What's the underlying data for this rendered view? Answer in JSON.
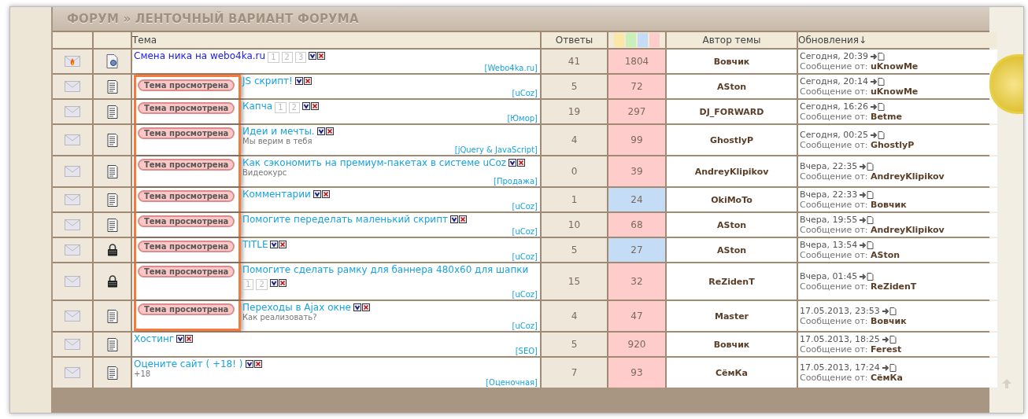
{
  "forum": {
    "title": "ФОРУМ » ЛЕНТОЧНЫЙ ВАРИАНТ ФОРУМА"
  },
  "table": {
    "columns": {
      "topic": "Тема",
      "replies": "Ответы",
      "author": "Автор темы",
      "updates": "Обновления↓"
    },
    "rows": [
      {
        "status_icon": {
          "kind": "hot"
        },
        "type_icon": {
          "kind": "special"
        },
        "viewed": false,
        "visited": false,
        "title": "Смена ника на webo4ka.ru",
        "pages": [
          "1",
          "2",
          "3"
        ],
        "category": "[Webo4ka.ru]",
        "replies": "41",
        "views": "1804",
        "color": "#ffcccc",
        "author": "Вовчик",
        "date": "Сегодня, 20:39",
        "last_post": "Сообщение от: **uKnowMe**"
      },
      {
        "status_icon": {
          "kind": "normal"
        },
        "type_icon": {
          "kind": "doc"
        },
        "viewed": true,
        "viewed_badge": "Тема просмотрена",
        "visited": true,
        "title": "JS скрипт!",
        "category": "[uCoz]",
        "replies": "5",
        "views": "72",
        "color": "#ffcccc",
        "author": "ASton",
        "date": "Сегодня, 20:14",
        "last_post": "Сообщение от: **uKnowMe**"
      },
      {
        "status_icon": {
          "kind": "normal"
        },
        "type_icon": {
          "kind": "doc"
        },
        "viewed": true,
        "viewed_badge": "Тема просмотрена",
        "visited": true,
        "title": "Капча",
        "pages": [
          "1",
          "2"
        ],
        "category": "[Юмор]",
        "replies": "19",
        "views": "297",
        "color": "#ffcccc",
        "author": "DJ_FORWARD",
        "date": "Сегодня, 16:26",
        "last_post": "Сообщение от: **Betme**"
      },
      {
        "status_icon": {
          "kind": "normal"
        },
        "type_icon": {
          "kind": "doc"
        },
        "viewed": true,
        "viewed_badge": "Тема просмотрена",
        "visited": true,
        "title": "Идеи и мечты.",
        "description": "Мы верим в тебя",
        "category": "[jQuery & JavaScript]",
        "replies": "4",
        "views": "99",
        "color": "#ffcccc",
        "author": "GhostlyP",
        "date": "Сегодня, 00:25",
        "last_post": "Сообщение от: **GhostlyP**"
      },
      {
        "status_icon": {
          "kind": "normal"
        },
        "type_icon": {
          "kind": "doc"
        },
        "viewed": true,
        "viewed_badge": "Тема просмотрена",
        "visited": true,
        "title": "Как сэкономить на премиум-пакетах в системе uCoz",
        "description": "Видеокурс",
        "category": "[Продажа]",
        "replies": "0",
        "views": "39",
        "color": "#ffcccc",
        "author": "AndreyKlipikov",
        "date": "Вчера, 22:35",
        "last_post": "Сообщение от: **AndreyKlipikov**"
      },
      {
        "status_icon": {
          "kind": "normal"
        },
        "type_icon": {
          "kind": "doc"
        },
        "viewed": true,
        "viewed_badge": "Тема просмотрена",
        "visited": true,
        "title": "Комментарии",
        "category": "[uCoz]",
        "replies": "1",
        "views": "24",
        "color": "#c4dcf5",
        "author": "OkiMoTo",
        "date": "Вчера, 22:33",
        "last_post": "Сообщение от: **Вовчик**"
      },
      {
        "status_icon": {
          "kind": "normal"
        },
        "type_icon": {
          "kind": "doc"
        },
        "viewed": true,
        "viewed_badge": "Тема просмотрена",
        "visited": true,
        "title": "Помогите переделать маленький скрипт",
        "category": "[uCoz]",
        "replies": "10",
        "views": "68",
        "color": "#ffcccc",
        "author": "ASton",
        "date": "Вчера, 19:55",
        "last_post": "Сообщение от: **AndreyKlipikov**"
      },
      {
        "status_icon": {
          "kind": "normal"
        },
        "type_icon": {
          "kind": "locked"
        },
        "viewed": true,
        "viewed_badge": "Тема просмотрена",
        "visited": true,
        "title": "TITLE",
        "category": "[uCoz]",
        "replies": "5",
        "views": "27",
        "color": "#c4dcf5",
        "author": "ASton",
        "date": "Вчера, 13:54",
        "last_post": "Сообщение от: **ASton**"
      },
      {
        "status_icon": {
          "kind": "normal"
        },
        "type_icon": {
          "kind": "locked"
        },
        "viewed": true,
        "viewed_badge": "Тема просмотрена",
        "visited": true,
        "title": "Помогите сделать рамку для баннера 480x60 для шапки",
        "pages": [
          "1",
          "2"
        ],
        "category": "[uCoz]",
        "replies": "15",
        "views": "32",
        "color": "#ffcccc",
        "author": "ReZidenT",
        "date": "Вчера, 01:45",
        "last_post": "Сообщение от: **ReZidenT**"
      },
      {
        "status_icon": {
          "kind": "normal"
        },
        "type_icon": {
          "kind": "doc"
        },
        "viewed": true,
        "viewed_badge": "Тема просмотрена",
        "visited": true,
        "title": "Переходы в Ajax окне",
        "description": "Как реализовать?",
        "category": "[uCoz]",
        "replies": "4",
        "views": "47",
        "color": "#ffcccc",
        "author": "Master",
        "date": "17.05.2013, 23:53",
        "last_post": "Сообщение от: **Вовчик**"
      },
      {
        "status_icon": {
          "kind": "normal"
        },
        "type_icon": {
          "kind": "doc"
        },
        "viewed": false,
        "visited": true,
        "title": "Хостинг",
        "category": "[SEO]",
        "replies": "5",
        "views": "920",
        "color": "#ffcccc",
        "author": "Вовчик",
        "date": "17.05.2013, 18:25",
        "last_post": "Сообщение от: **Ferest**"
      },
      {
        "status_icon": {
          "kind": "normal"
        },
        "type_icon": {
          "kind": "doc"
        },
        "viewed": false,
        "visited": true,
        "title": "Оцените сайт ( +18! )",
        "description": "+18",
        "category": "[Оценочная]",
        "replies": "7",
        "views": "93",
        "color": "#ffcccc",
        "author": "СёмКа",
        "date": "17.05.2013, 17:24",
        "last_post": "Сообщение от: **СёмКа**"
      }
    ]
  }
}
